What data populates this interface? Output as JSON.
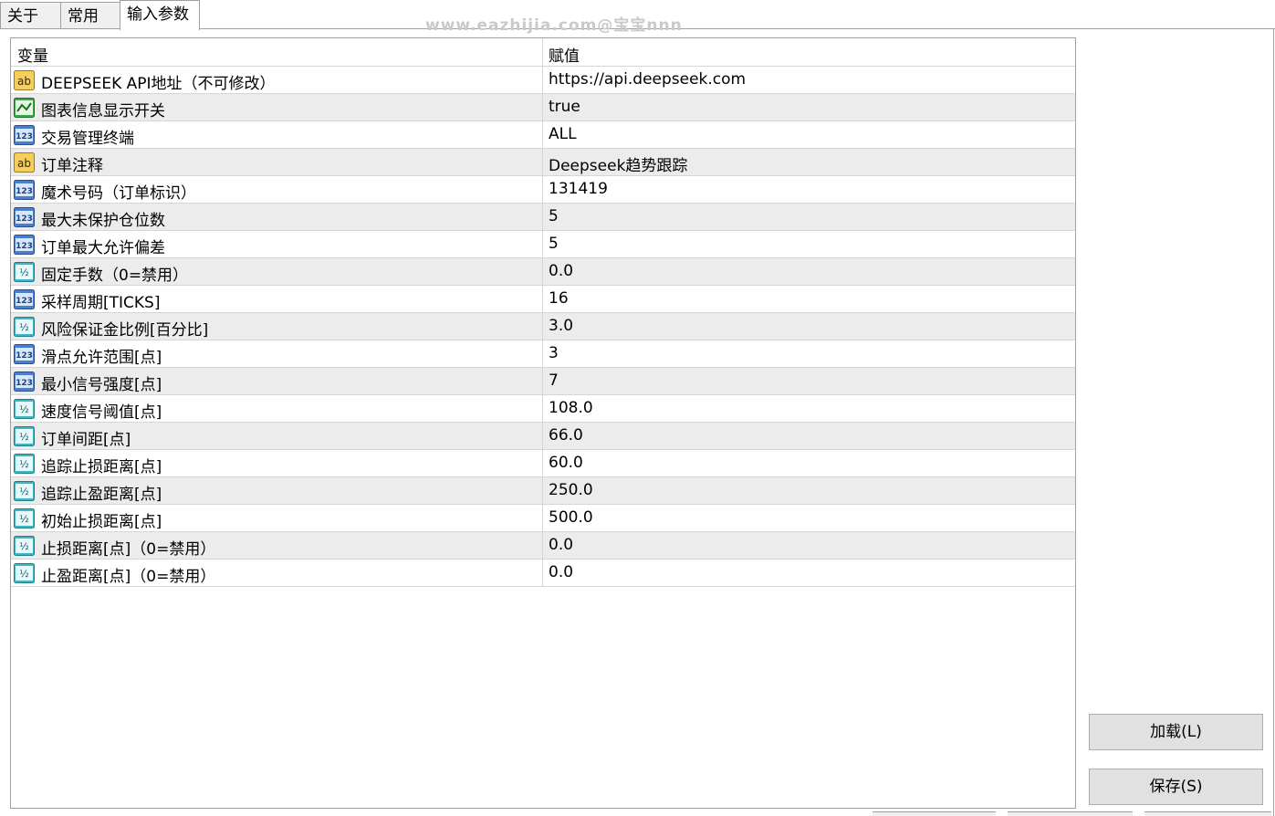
{
  "tabs": [
    {
      "label": "关于",
      "active": false
    },
    {
      "label": "常用",
      "active": false
    },
    {
      "label": "输入参数",
      "active": true
    }
  ],
  "watermark": "www.eazhijia.com@宝宝nnn",
  "grid": {
    "headers": {
      "variable": "变量",
      "value": "赋值"
    },
    "rows": [
      {
        "icon": "string-type-icon",
        "name": "DEEPSEEK API地址（不可修改）",
        "value": "https://api.deepseek.com"
      },
      {
        "icon": "bool-type-icon",
        "name": "图表信息显示开关",
        "value": "true"
      },
      {
        "icon": "int-type-icon",
        "name": "交易管理终端",
        "value": "ALL"
      },
      {
        "icon": "string-type-icon",
        "name": "订单注释",
        "value": "Deepseek趋势跟踪"
      },
      {
        "icon": "int-type-icon",
        "name": "魔术号码（订单标识）",
        "value": "131419"
      },
      {
        "icon": "int-type-icon",
        "name": "最大未保护仓位数",
        "value": "5"
      },
      {
        "icon": "int-type-icon",
        "name": "订单最大允许偏差",
        "value": "5"
      },
      {
        "icon": "double-type-icon",
        "name": "固定手数（0=禁用）",
        "value": "0.0"
      },
      {
        "icon": "int-type-icon",
        "name": "采样周期[TICKS]",
        "value": "16"
      },
      {
        "icon": "double-type-icon",
        "name": "风险保证金比例[百分比]",
        "value": "3.0"
      },
      {
        "icon": "int-type-icon",
        "name": "滑点允许范围[点]",
        "value": "3"
      },
      {
        "icon": "int-type-icon",
        "name": "最小信号强度[点]",
        "value": "7"
      },
      {
        "icon": "double-type-icon",
        "name": "速度信号阈值[点]",
        "value": "108.0"
      },
      {
        "icon": "double-type-icon",
        "name": "订单间距[点]",
        "value": "66.0"
      },
      {
        "icon": "double-type-icon",
        "name": "追踪止损距离[点]",
        "value": "60.0"
      },
      {
        "icon": "double-type-icon",
        "name": "追踪止盈距离[点]",
        "value": "250.0"
      },
      {
        "icon": "double-type-icon",
        "name": "初始止损距离[点]",
        "value": "500.0"
      },
      {
        "icon": "double-type-icon",
        "name": "止损距离[点]（0=禁用）",
        "value": "0.0"
      },
      {
        "icon": "double-type-icon",
        "name": "止盈距离[点]（0=禁用）",
        "value": "0.0"
      }
    ]
  },
  "buttons": {
    "load": "加载(L)",
    "save": "保存(S)"
  },
  "icon_glyphs": {
    "string-type-icon": "ab",
    "int-type-icon": "123",
    "double-type-icon": "½",
    "bool-type-icon": "~"
  },
  "colors": {
    "row_alt": "#ececec",
    "grid_border": "#a0a0a0",
    "button_bg": "#e1e1e1"
  }
}
